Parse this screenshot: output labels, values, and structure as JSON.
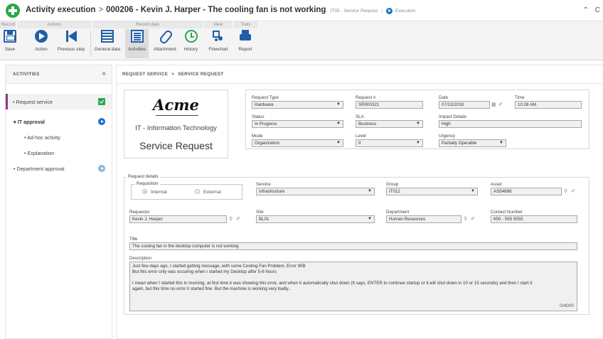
{
  "window": {
    "app_name": "Activity execution",
    "breadcrumb_sep": ">",
    "record_title": "000206 - Kevin J. Harper - The cooling fan is not working",
    "process": "IT05 - Service Request",
    "sep": "|",
    "stage": "Execution",
    "chevron_up": "⌃",
    "refresh_partial": "C"
  },
  "ribbon": {
    "groups": [
      "Record",
      "Actions",
      "Record data",
      "View",
      "Tools"
    ],
    "buttons": {
      "save": "Save",
      "action": "Action",
      "previous_step": "Previous step",
      "general_data": "General data",
      "activities": "Activities",
      "attachment": "Attachment",
      "history": "History",
      "flowchart": "Flowchart",
      "report": "Report"
    }
  },
  "sidebar": {
    "header": "ACTIVITIES",
    "collapse": "«",
    "items": [
      {
        "label": "• Request service",
        "status": "done"
      },
      {
        "label": "▾ IT approval",
        "status": "running"
      },
      {
        "label": "• Ad-hoc activity",
        "status": ""
      },
      {
        "label": "• Explanation",
        "status": ""
      },
      {
        "label": "• Department approval",
        "status": "pending"
      }
    ]
  },
  "main": {
    "breadcrumb_1": "REQUEST SERVICE",
    "breadcrumb_arrow": ">",
    "breadcrumb_2": "SERVICE REQUEST"
  },
  "brand": {
    "logo_text": "Acme",
    "department": "IT - Information Technology",
    "form_title": "Service Request"
  },
  "header_form": {
    "request_type": {
      "label": "Request Type",
      "value": "Hardware"
    },
    "request_no": {
      "label": "Request #",
      "value": "SR000321"
    },
    "date": {
      "label": "Date",
      "value": "07/13/2018"
    },
    "time": {
      "label": "Time",
      "value": "10:28 AM"
    },
    "status": {
      "label": "Status",
      "value": "In Progress"
    },
    "sla": {
      "label": "SLA",
      "value": "Business"
    },
    "impact": {
      "label": "Impact Details",
      "value": "High"
    },
    "mode": {
      "label": "Mode",
      "value": "Organization"
    },
    "level": {
      "label": "Level",
      "value": "II"
    },
    "urgency": {
      "label": "Urgency",
      "value": "Partially Operable"
    }
  },
  "details": {
    "legend": "Request details",
    "requisition": {
      "label": "Requisition",
      "internal": "Internal",
      "external": "External",
      "selected": "Internal"
    },
    "service": {
      "label": "Service",
      "value": "Infrastructure"
    },
    "group": {
      "label": "Group",
      "value": "IT012"
    },
    "asset": {
      "label": "Asset",
      "value": "AS54888"
    },
    "requestor": {
      "label": "Requestor",
      "value": "Kevin J. Harper"
    },
    "site": {
      "label": "Site",
      "value": "BL01"
    },
    "department": {
      "label": "Department",
      "value": "Human Resources"
    },
    "contact": {
      "label": "Contact Number",
      "value": "650 - 555 5555"
    },
    "title": {
      "label": "Title",
      "value": "The cooling fan in the desktop computer is not working"
    },
    "description": {
      "label": "Description",
      "line1": "Just few days ago, I started getting message, with some Cooling Fan Problem, Error 90B",
      "line2": "But this error only was occuring when i started my Desktop after 5-6 hours",
      "line3": "I mean when I started this in morning, at first time it was showing this error, and when it automatically shut down (It says, ENTER to continue startup or it will shut down in 10 or 15 seconds) and then I start it",
      "line4": "again, but this time no error it started fine. But the machine is working very badly..",
      "counter": "0/4000"
    }
  }
}
